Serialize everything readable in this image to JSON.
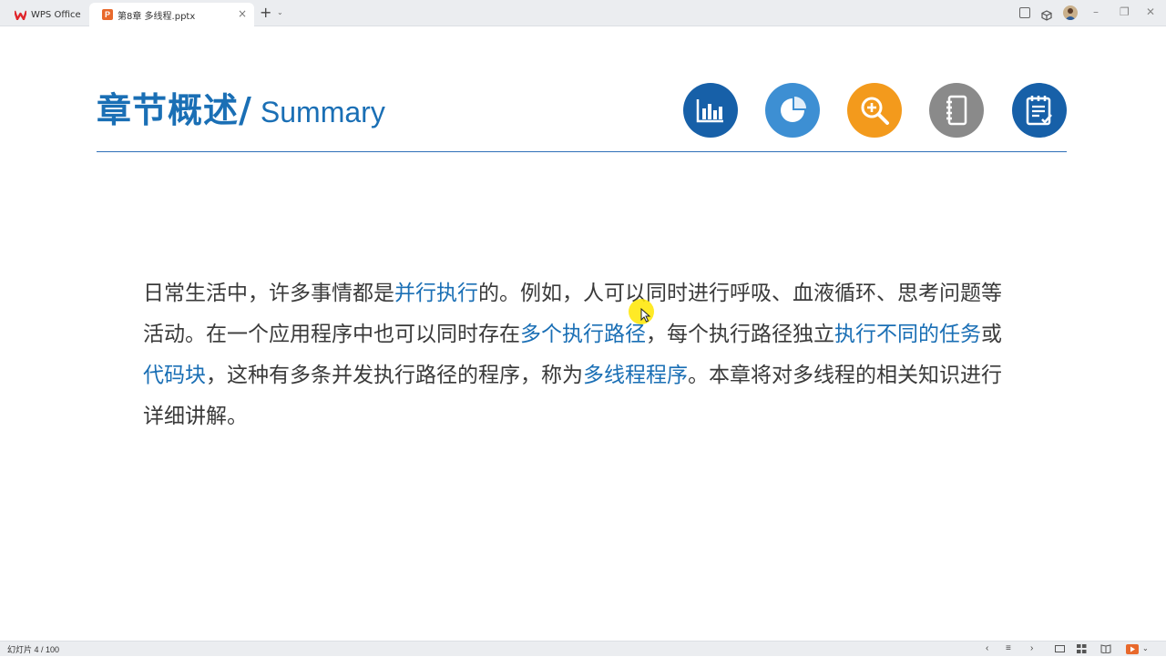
{
  "titlebar": {
    "home_tab_label": "WPS Office",
    "doc_tab_label": "第8章 多线程.pptx",
    "doc_tab_badge": "P",
    "close_glyph": "×",
    "new_tab_glyph": "+",
    "new_tab_dropdown_glyph": "⌄",
    "window_minimize": "–",
    "window_restore": "❐",
    "window_close": "✕"
  },
  "slide": {
    "title_cn": "章节概述",
    "title_slash": "/",
    "title_en": "Summary",
    "icons": [
      {
        "name": "bar-chart-icon",
        "color": "#1760a8"
      },
      {
        "name": "pie-chart-icon",
        "color": "#3d8fd3"
      },
      {
        "name": "magnifier-plus-icon",
        "color": "#f39a1c"
      },
      {
        "name": "notebook-icon",
        "color": "#8a8a8a"
      },
      {
        "name": "checklist-icon",
        "color": "#1760a8"
      }
    ],
    "paragraph": [
      {
        "text": "日常生活中，许多事情都是",
        "highlight": false
      },
      {
        "text": "并行执行",
        "highlight": true
      },
      {
        "text": "的。例如，人可以同时进行呼吸、血液循环、思考问题等活动。在一个应用程序中也可以同时存在",
        "highlight": false
      },
      {
        "text": "多个执行路径",
        "highlight": true
      },
      {
        "text": "，每个执行路径独立",
        "highlight": false
      },
      {
        "text": "执行不同的任务",
        "highlight": true
      },
      {
        "text": "或",
        "highlight": false
      },
      {
        "text": "代码块",
        "highlight": true
      },
      {
        "text": "，这种有多条并发执行路径的程序，称为",
        "highlight": false
      },
      {
        "text": "多线程程序",
        "highlight": true
      },
      {
        "text": "。本章将对多线程的相关知识进行详细讲解。",
        "highlight": false
      }
    ],
    "highlight_color": "#1a6fb5",
    "text_color": "#3a3a3a"
  },
  "statusbar": {
    "slide_indicator": "幻灯片 4 / 100",
    "prev_glyph": "‹",
    "next_glyph": "›",
    "notes_glyph": "≡"
  }
}
